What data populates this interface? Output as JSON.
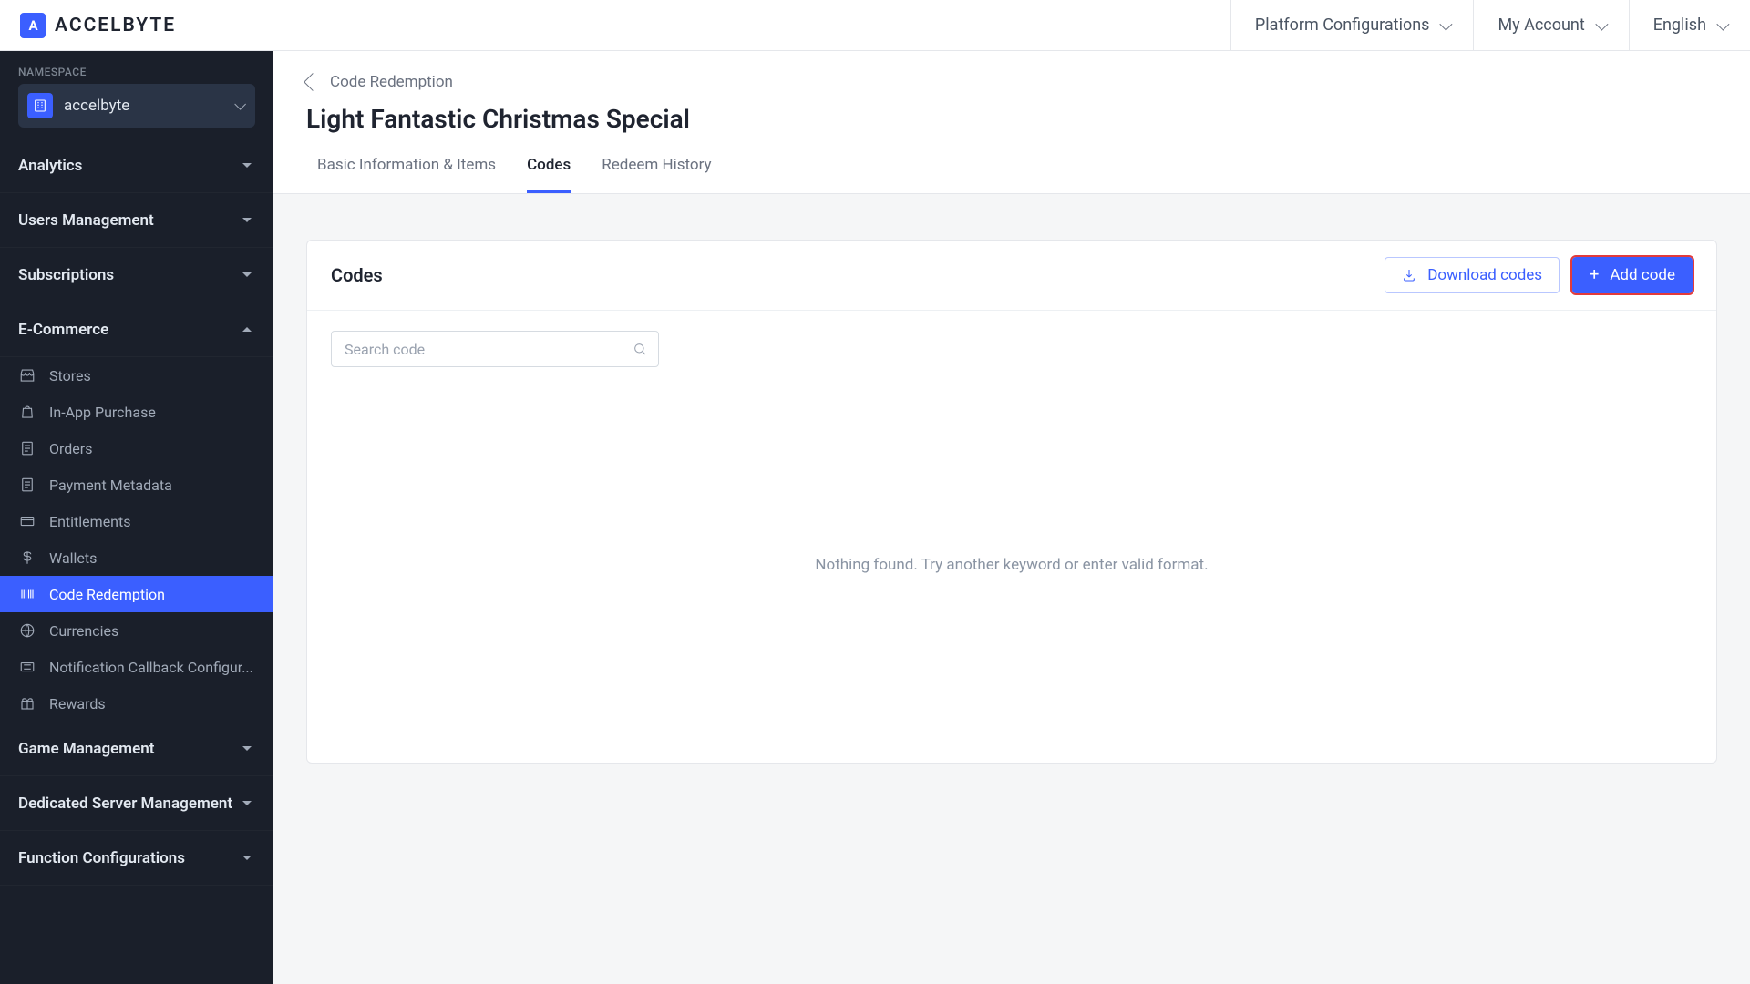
{
  "brand": {
    "mark": "A",
    "name": "ACCELBYTE"
  },
  "header": {
    "platform": "Platform Configurations",
    "account": "My Account",
    "language": "English"
  },
  "sidebar": {
    "ns_label": "NAMESPACE",
    "namespace": "accelbyte",
    "sections": {
      "analytics": "Analytics",
      "users": "Users Management",
      "subscriptions": "Subscriptions",
      "ecommerce": "E-Commerce",
      "game": "Game Management",
      "dedicated": "Dedicated Server Management",
      "function": "Function Configurations"
    },
    "ecommerce_items": {
      "stores": "Stores",
      "iap": "In-App Purchase",
      "orders": "Orders",
      "payment": "Payment Metadata",
      "entitlements": "Entitlements",
      "wallets": "Wallets",
      "code_redemption": "Code Redemption",
      "currencies": "Currencies",
      "notification": "Notification Callback Configur...",
      "rewards": "Rewards"
    }
  },
  "page": {
    "breadcrumb": "Code Redemption",
    "title": "Light Fantastic Christmas Special",
    "tabs": {
      "basic": "Basic Information & Items",
      "codes": "Codes",
      "history": "Redeem History"
    }
  },
  "card": {
    "title": "Codes",
    "download": "Download codes",
    "add": "Add code",
    "search_placeholder": "Search code",
    "empty": "Nothing found. Try another keyword or enter valid format."
  }
}
